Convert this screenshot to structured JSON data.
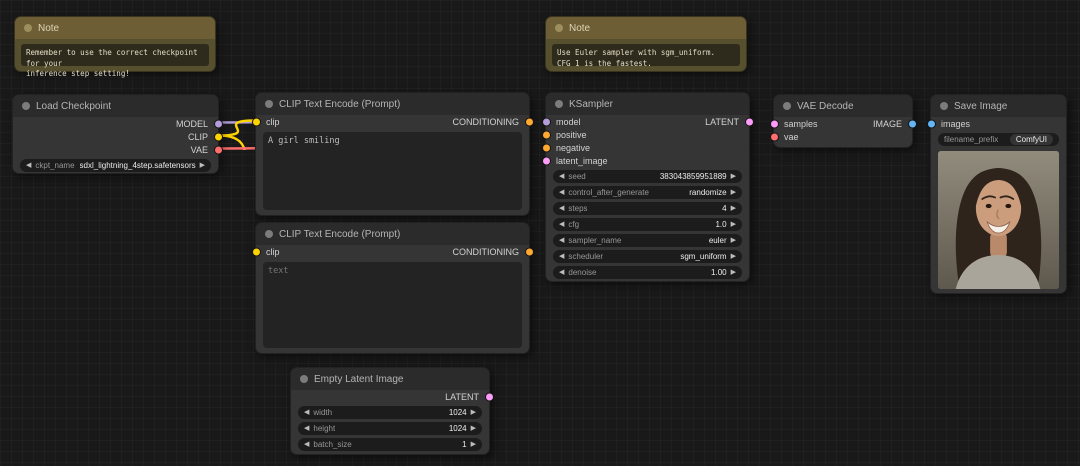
{
  "colors": {
    "model": "#B39DDB",
    "clip": "#FFD500",
    "vae": "#FF6E6E",
    "conditioning": "#FFA931",
    "latent": "#FF9CF9",
    "image": "#64B5F6"
  },
  "icons": {
    "arrow_left": "◀",
    "arrow_right": "▶"
  },
  "nodes": {
    "note1": {
      "title": "Note",
      "text": "Remember to use the correct checkpoint for your\ninference step setting!"
    },
    "note2": {
      "title": "Note",
      "text": "Use Euler sampler with sgm_uniform.\nCFG 1 is the fastest."
    },
    "load_checkpoint": {
      "title": "Load Checkpoint",
      "outputs": [
        "MODEL",
        "CLIP",
        "VAE"
      ],
      "widgets": [
        {
          "label": "ckpt_name",
          "value": "sdxl_lightning_4step.safetensors"
        }
      ]
    },
    "clip_encode_1": {
      "title": "CLIP Text Encode (Prompt)",
      "input": "clip",
      "output": "CONDITIONING",
      "text": "A girl smiling"
    },
    "clip_encode_2": {
      "title": "CLIP Text Encode (Prompt)",
      "input": "clip",
      "output": "CONDITIONING",
      "text": "text"
    },
    "empty_latent": {
      "title": "Empty Latent Image",
      "output": "LATENT",
      "widgets": [
        {
          "label": "width",
          "value": "1024"
        },
        {
          "label": "height",
          "value": "1024"
        },
        {
          "label": "batch_size",
          "value": "1"
        }
      ]
    },
    "ksampler": {
      "title": "KSampler",
      "inputs": [
        "model",
        "positive",
        "negative",
        "latent_image"
      ],
      "output": "LATENT",
      "widgets": [
        {
          "label": "seed",
          "value": "383043859951889"
        },
        {
          "label": "control_after_generate",
          "value": "randomize"
        },
        {
          "label": "steps",
          "value": "4"
        },
        {
          "label": "cfg",
          "value": "1.0"
        },
        {
          "label": "sampler_name",
          "value": "euler"
        },
        {
          "label": "scheduler",
          "value": "sgm_uniform"
        },
        {
          "label": "denoise",
          "value": "1.00"
        }
      ]
    },
    "vae_decode": {
      "title": "VAE Decode",
      "inputs": [
        "samples",
        "vae"
      ],
      "output": "IMAGE"
    },
    "save_image": {
      "title": "Save Image",
      "input": "images",
      "widgets": [
        {
          "label": "filename_prefix",
          "value": "ComfyUI"
        }
      ]
    }
  }
}
